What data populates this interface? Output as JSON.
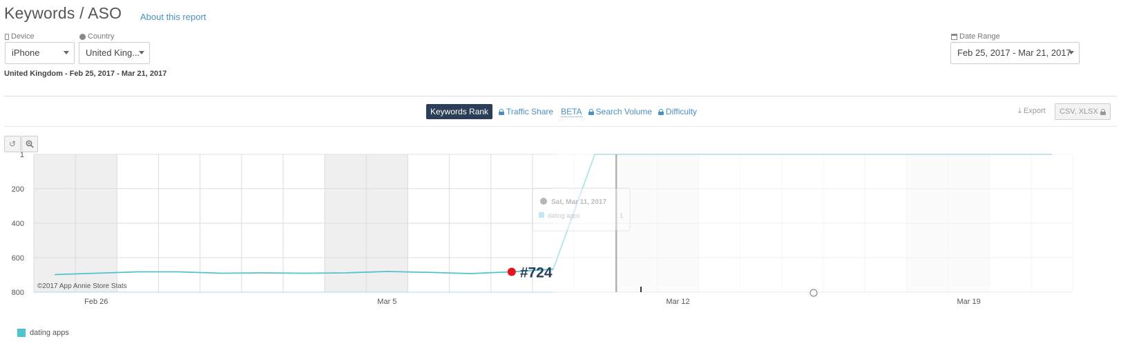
{
  "header": {
    "title": "Keywords / ASO",
    "about_link": "About this report"
  },
  "filters": {
    "device": {
      "label": "Device",
      "value": "iPhone"
    },
    "country": {
      "label": "Country",
      "value": "United King..."
    },
    "date_range": {
      "label": "Date Range",
      "value": "Feb 25, 2017 - Mar 21, 2017"
    }
  },
  "subtitle": "United Kingdom - Feb 25, 2017 - Mar 21, 2017",
  "tabs": {
    "keywords_rank": "Keywords Rank",
    "traffic_share": "Traffic Share",
    "beta": "BETA",
    "search_volume": "Search Volume",
    "difficulty": "Difficulty"
  },
  "export": {
    "label": "Export",
    "formats": "CSV, XLSX"
  },
  "chart_data": {
    "type": "line",
    "y_inverted": true,
    "ylim": [
      1,
      800
    ],
    "yticks": [
      "1",
      "200",
      "400",
      "600",
      "800"
    ],
    "xticks": [
      "Feb 26",
      "Mar 5",
      "Mar 12",
      "Mar 19"
    ],
    "credit": "©2017 App Annie Store Stats",
    "series": [
      {
        "name": "dating apps",
        "color": "#4fc3cf",
        "x": [
          "Feb 25",
          "Feb 26",
          "Feb 27",
          "Feb 28",
          "Mar 1",
          "Mar 2",
          "Mar 3",
          "Mar 4",
          "Mar 5",
          "Mar 6",
          "Mar 7",
          "Mar 8",
          "Mar 9",
          "Mar 10",
          "Mar 11",
          "Mar 12",
          "Mar 13",
          "Mar 14",
          "Mar 15",
          "Mar 16",
          "Mar 17",
          "Mar 18",
          "Mar 19",
          "Mar 20",
          "Mar 21"
        ],
        "values": [
          698,
          690,
          682,
          682,
          690,
          688,
          690,
          688,
          680,
          685,
          692,
          682,
          667,
          1,
          1,
          1,
          1,
          1,
          1,
          1,
          1,
          1,
          1,
          1,
          1
        ]
      }
    ],
    "highlight": {
      "label": "#724",
      "x": "Mar 8"
    },
    "tooltip": {
      "date": "Sat, Mar 11, 2017",
      "series": "dating apps",
      "value": "1"
    }
  }
}
